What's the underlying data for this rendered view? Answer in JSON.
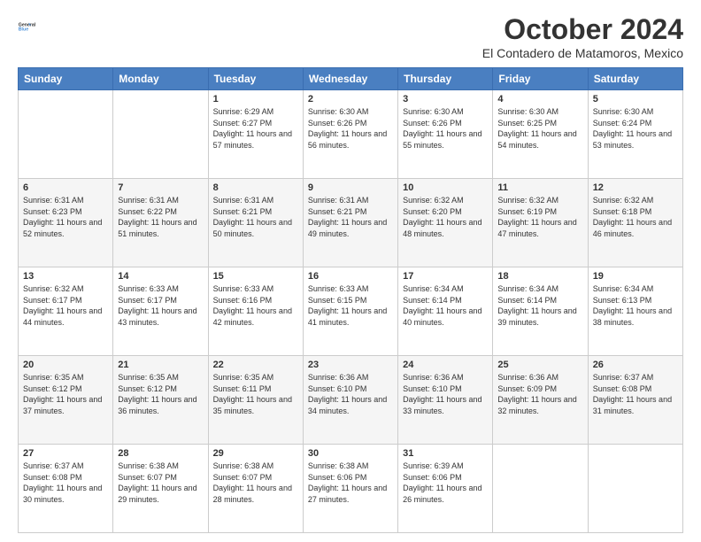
{
  "header": {
    "logo_general": "General",
    "logo_blue": "Blue",
    "month_title": "October 2024",
    "location": "El Contadero de Matamoros, Mexico"
  },
  "days_of_week": [
    "Sunday",
    "Monday",
    "Tuesday",
    "Wednesday",
    "Thursday",
    "Friday",
    "Saturday"
  ],
  "weeks": [
    [
      {
        "day": "",
        "info": ""
      },
      {
        "day": "",
        "info": ""
      },
      {
        "day": "1",
        "info": "Sunrise: 6:29 AM\nSunset: 6:27 PM\nDaylight: 11 hours and 57 minutes."
      },
      {
        "day": "2",
        "info": "Sunrise: 6:30 AM\nSunset: 6:26 PM\nDaylight: 11 hours and 56 minutes."
      },
      {
        "day": "3",
        "info": "Sunrise: 6:30 AM\nSunset: 6:26 PM\nDaylight: 11 hours and 55 minutes."
      },
      {
        "day": "4",
        "info": "Sunrise: 6:30 AM\nSunset: 6:25 PM\nDaylight: 11 hours and 54 minutes."
      },
      {
        "day": "5",
        "info": "Sunrise: 6:30 AM\nSunset: 6:24 PM\nDaylight: 11 hours and 53 minutes."
      }
    ],
    [
      {
        "day": "6",
        "info": "Sunrise: 6:31 AM\nSunset: 6:23 PM\nDaylight: 11 hours and 52 minutes."
      },
      {
        "day": "7",
        "info": "Sunrise: 6:31 AM\nSunset: 6:22 PM\nDaylight: 11 hours and 51 minutes."
      },
      {
        "day": "8",
        "info": "Sunrise: 6:31 AM\nSunset: 6:21 PM\nDaylight: 11 hours and 50 minutes."
      },
      {
        "day": "9",
        "info": "Sunrise: 6:31 AM\nSunset: 6:21 PM\nDaylight: 11 hours and 49 minutes."
      },
      {
        "day": "10",
        "info": "Sunrise: 6:32 AM\nSunset: 6:20 PM\nDaylight: 11 hours and 48 minutes."
      },
      {
        "day": "11",
        "info": "Sunrise: 6:32 AM\nSunset: 6:19 PM\nDaylight: 11 hours and 47 minutes."
      },
      {
        "day": "12",
        "info": "Sunrise: 6:32 AM\nSunset: 6:18 PM\nDaylight: 11 hours and 46 minutes."
      }
    ],
    [
      {
        "day": "13",
        "info": "Sunrise: 6:32 AM\nSunset: 6:17 PM\nDaylight: 11 hours and 44 minutes."
      },
      {
        "day": "14",
        "info": "Sunrise: 6:33 AM\nSunset: 6:17 PM\nDaylight: 11 hours and 43 minutes."
      },
      {
        "day": "15",
        "info": "Sunrise: 6:33 AM\nSunset: 6:16 PM\nDaylight: 11 hours and 42 minutes."
      },
      {
        "day": "16",
        "info": "Sunrise: 6:33 AM\nSunset: 6:15 PM\nDaylight: 11 hours and 41 minutes."
      },
      {
        "day": "17",
        "info": "Sunrise: 6:34 AM\nSunset: 6:14 PM\nDaylight: 11 hours and 40 minutes."
      },
      {
        "day": "18",
        "info": "Sunrise: 6:34 AM\nSunset: 6:14 PM\nDaylight: 11 hours and 39 minutes."
      },
      {
        "day": "19",
        "info": "Sunrise: 6:34 AM\nSunset: 6:13 PM\nDaylight: 11 hours and 38 minutes."
      }
    ],
    [
      {
        "day": "20",
        "info": "Sunrise: 6:35 AM\nSunset: 6:12 PM\nDaylight: 11 hours and 37 minutes."
      },
      {
        "day": "21",
        "info": "Sunrise: 6:35 AM\nSunset: 6:12 PM\nDaylight: 11 hours and 36 minutes."
      },
      {
        "day": "22",
        "info": "Sunrise: 6:35 AM\nSunset: 6:11 PM\nDaylight: 11 hours and 35 minutes."
      },
      {
        "day": "23",
        "info": "Sunrise: 6:36 AM\nSunset: 6:10 PM\nDaylight: 11 hours and 34 minutes."
      },
      {
        "day": "24",
        "info": "Sunrise: 6:36 AM\nSunset: 6:10 PM\nDaylight: 11 hours and 33 minutes."
      },
      {
        "day": "25",
        "info": "Sunrise: 6:36 AM\nSunset: 6:09 PM\nDaylight: 11 hours and 32 minutes."
      },
      {
        "day": "26",
        "info": "Sunrise: 6:37 AM\nSunset: 6:08 PM\nDaylight: 11 hours and 31 minutes."
      }
    ],
    [
      {
        "day": "27",
        "info": "Sunrise: 6:37 AM\nSunset: 6:08 PM\nDaylight: 11 hours and 30 minutes."
      },
      {
        "day": "28",
        "info": "Sunrise: 6:38 AM\nSunset: 6:07 PM\nDaylight: 11 hours and 29 minutes."
      },
      {
        "day": "29",
        "info": "Sunrise: 6:38 AM\nSunset: 6:07 PM\nDaylight: 11 hours and 28 minutes."
      },
      {
        "day": "30",
        "info": "Sunrise: 6:38 AM\nSunset: 6:06 PM\nDaylight: 11 hours and 27 minutes."
      },
      {
        "day": "31",
        "info": "Sunrise: 6:39 AM\nSunset: 6:06 PM\nDaylight: 11 hours and 26 minutes."
      },
      {
        "day": "",
        "info": ""
      },
      {
        "day": "",
        "info": ""
      }
    ]
  ]
}
